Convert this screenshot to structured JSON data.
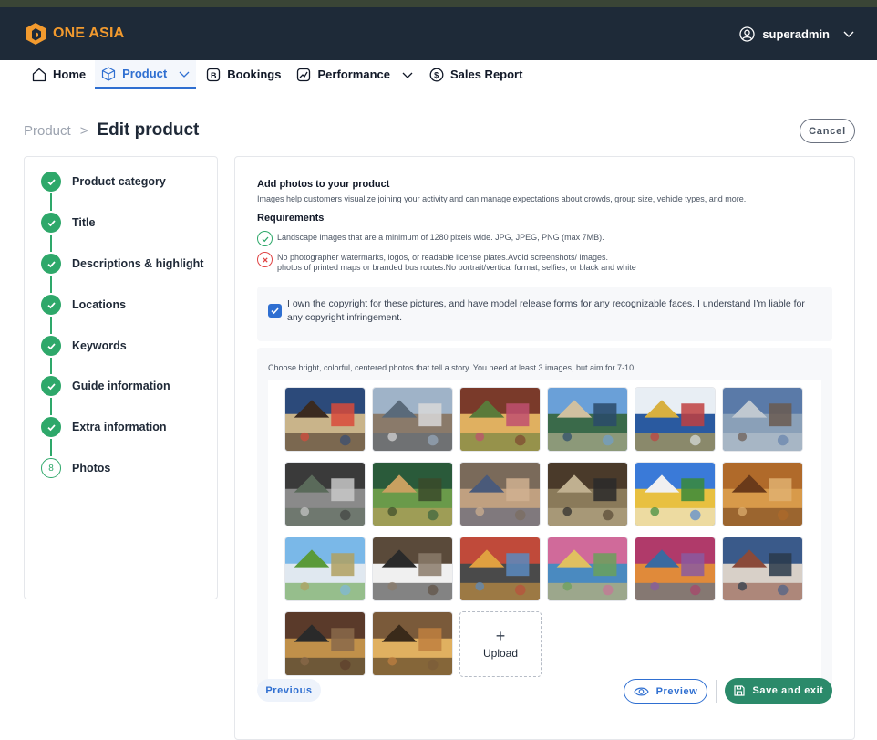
{
  "brand": {
    "name": "ONE ASIA",
    "accent": "#f29a2e"
  },
  "user": {
    "name": "superadmin"
  },
  "nav": {
    "items": [
      {
        "label": "Home",
        "icon": "home-icon"
      },
      {
        "label": "Product",
        "icon": "box-icon",
        "active": true,
        "has_dropdown": true
      },
      {
        "label": "Bookings",
        "icon": "bookings-icon"
      },
      {
        "label": "Performance",
        "icon": "chart-icon",
        "has_dropdown": true
      },
      {
        "label": "Sales Report",
        "icon": "dollar-icon"
      }
    ]
  },
  "breadcrumb": {
    "parent": "Product",
    "separator": ">",
    "current": "Edit product"
  },
  "cancel_label": "Cancel",
  "steps": [
    {
      "label": "Product category",
      "status": "done"
    },
    {
      "label": "Title",
      "status": "done"
    },
    {
      "label": "Descriptions & highlight",
      "status": "done"
    },
    {
      "label": "Locations",
      "status": "done"
    },
    {
      "label": "Keywords",
      "status": "done"
    },
    {
      "label": "Guide information",
      "status": "done"
    },
    {
      "label": "Extra information",
      "status": "done"
    },
    {
      "label": "Photos",
      "status": "current",
      "number": "8"
    }
  ],
  "photos_section": {
    "title": "Add photos to your product",
    "description": "Images help customers visualize joining your activity and can manage expectations about crowds, group size, vehicle types, and more.",
    "requirements_title": "Requirements",
    "requirement_ok": "Landscape images that are a minimum of 1280 pixels wide. JPG, JPEG, PNG (max 7MB).",
    "requirement_bad_line1": "No photographer watermarks, logos, or readable license plates.Avoid screenshots/ images.",
    "requirement_bad_line2": "photos of printed maps or branded bus routes.No portrait/vertical format, selfies, or black and white",
    "consent_text": "I own the copyright for these pictures, and have model release forms for any recognizable faces. I understand I’m liable for any copyright infringement.",
    "consent_checked": true,
    "hint": "Choose bright, colorful, centered photos that tell a story. You need at least 3 images, but aim for 7-10.",
    "upload_label": "Upload",
    "photo_count": 20
  },
  "footer": {
    "previous_label": "Previous",
    "preview_label": "Preview",
    "save_label": "Save and exit"
  },
  "colors": {
    "header_bg": "#1e2a38",
    "primary": "#2f6fd1",
    "success": "#2ea86a",
    "save_button": "#2b8a6a",
    "error": "#e04444"
  }
}
